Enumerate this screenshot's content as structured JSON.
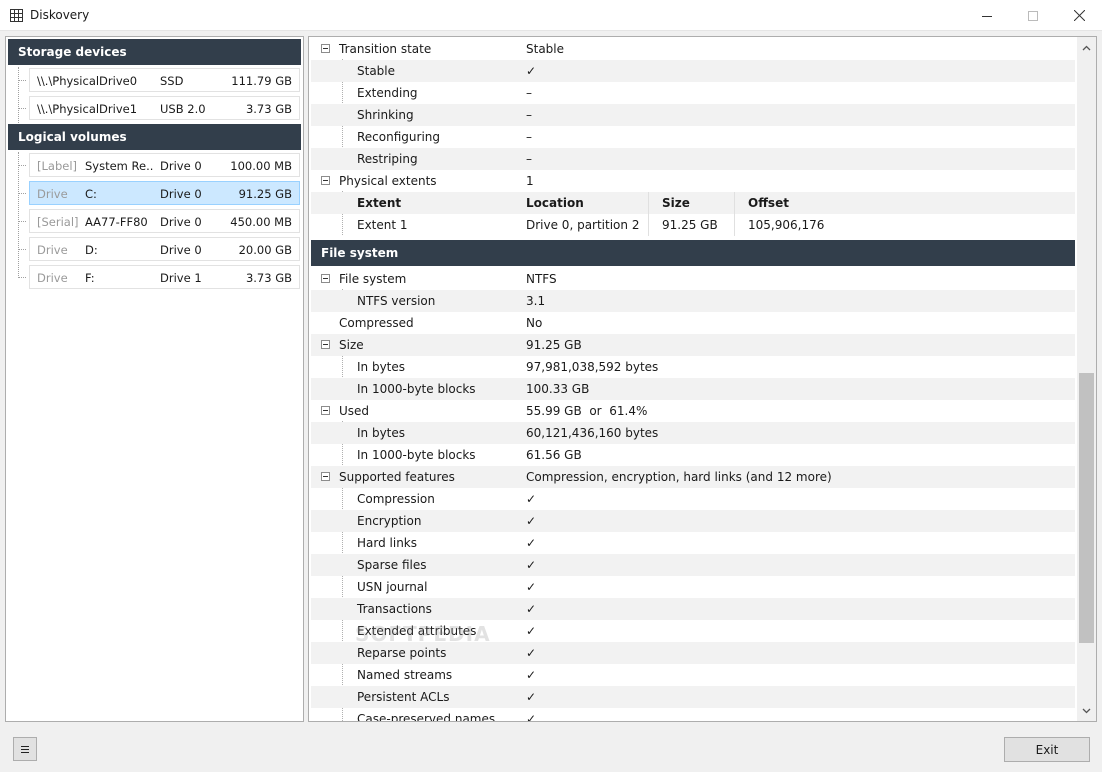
{
  "window": {
    "title": "Diskovery"
  },
  "storage": {
    "header": "Storage devices",
    "devices": [
      {
        "name": "\\\\.\\PhysicalDrive0",
        "type": "SSD",
        "size": "111.79 GB"
      },
      {
        "name": "\\\\.\\PhysicalDrive1",
        "type": "USB 2.0",
        "size": "3.73 GB"
      }
    ]
  },
  "volumes": {
    "header": "Logical volumes",
    "items": [
      {
        "kind": "[Label]",
        "name": "System Re...",
        "drive": "Drive 0",
        "size": "100.00 MB"
      },
      {
        "kind": "Drive",
        "name": "C:",
        "drive": "Drive 0",
        "size": "91.25 GB"
      },
      {
        "kind": "[Serial]",
        "name": "AA77-FF80",
        "drive": "Drive 0",
        "size": "450.00 MB"
      },
      {
        "kind": "Drive",
        "name": "D:",
        "drive": "Drive 0",
        "size": "20.00 GB"
      },
      {
        "kind": "Drive",
        "name": "F:",
        "drive": "Drive 1",
        "size": "3.73 GB"
      }
    ],
    "selected_index": 1
  },
  "details": {
    "transition": {
      "label": "Transition state",
      "value": "Stable",
      "children": [
        {
          "label": "Stable",
          "value": "✓"
        },
        {
          "label": "Extending",
          "value": "–"
        },
        {
          "label": "Shrinking",
          "value": "–"
        },
        {
          "label": "Reconfiguring",
          "value": "–"
        },
        {
          "label": "Restriping",
          "value": "–"
        }
      ]
    },
    "extents": {
      "label": "Physical extents",
      "value": "1",
      "columns": [
        "Extent",
        "Location",
        "Size",
        "Offset"
      ],
      "rows": [
        [
          "Extent 1",
          "Drive 0, partition 2",
          "91.25 GB",
          "105,906,176"
        ]
      ]
    },
    "filesystem_header": "File system",
    "filesystem": {
      "label": "File system",
      "value": "NTFS",
      "children": [
        {
          "label": "NTFS version",
          "value": "3.1"
        }
      ]
    },
    "compressed": {
      "label": "Compressed",
      "value": "No"
    },
    "size": {
      "label": "Size",
      "value": "91.25 GB",
      "children": [
        {
          "label": "In bytes",
          "value": "97,981,038,592 bytes"
        },
        {
          "label": "In 1000-byte blocks",
          "value": "100.33 GB"
        }
      ]
    },
    "used": {
      "label": "Used",
      "value": "55.99 GB  or  61.4%",
      "children": [
        {
          "label": "In bytes",
          "value": "60,121,436,160 bytes"
        },
        {
          "label": "In 1000-byte blocks",
          "value": "61.56 GB"
        }
      ]
    },
    "features": {
      "label": "Supported features",
      "value": "Compression, encryption, hard links (and 12 more)",
      "children": [
        {
          "label": "Compression",
          "value": "✓"
        },
        {
          "label": "Encryption",
          "value": "✓"
        },
        {
          "label": "Hard links",
          "value": "✓"
        },
        {
          "label": "Sparse files",
          "value": "✓"
        },
        {
          "label": "USN journal",
          "value": "✓"
        },
        {
          "label": "Transactions",
          "value": "✓"
        },
        {
          "label": "Extended attributes",
          "value": "✓"
        },
        {
          "label": "Reparse points",
          "value": "✓"
        },
        {
          "label": "Named streams",
          "value": "✓"
        },
        {
          "label": "Persistent ACLs",
          "value": "✓"
        },
        {
          "label": "Case-preserved names",
          "value": "✓"
        }
      ]
    }
  },
  "footer": {
    "menu_icon": "hamburger-icon",
    "exit_label": "Exit"
  },
  "watermark": "SOFTPEDIA"
}
